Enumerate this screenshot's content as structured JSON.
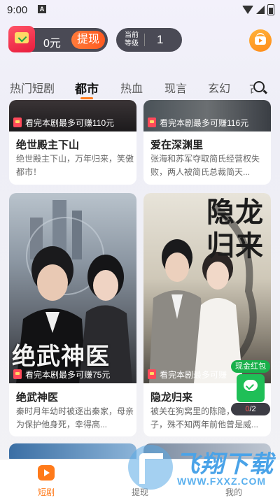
{
  "status_bar": {
    "time": "9:00",
    "alert": "A"
  },
  "header": {
    "coin_amount": "0元",
    "withdraw_label": "提现",
    "level_label": "当前等级",
    "level_value": "1"
  },
  "tabs": [
    {
      "label": "热门短剧",
      "active": false
    },
    {
      "label": "都市",
      "active": true
    },
    {
      "label": "热血",
      "active": false
    },
    {
      "label": "现言",
      "active": false
    },
    {
      "label": "玄幻",
      "active": false
    },
    {
      "label": "古",
      "active": false
    }
  ],
  "cards": [
    {
      "badge": "看完本剧最多可赚110元",
      "title": "绝世殿主下山",
      "desc": "绝世殿主下山，万年归来，笑傲都市！"
    },
    {
      "badge": "看完本剧最多可赚116元",
      "title": "爱在深渊里",
      "desc": "张海和苏军夺取简氏经营权失败，两人被简氏总裁简天..."
    },
    {
      "badge": "看完本剧最多可赚75元",
      "title": "绝武神医",
      "desc": "秦时月年幼时被逐出秦家，母亲为保护他身死，幸得高...",
      "poster_title": "绝武神医"
    },
    {
      "badge": "看完本剧最多可赚",
      "title": "隐龙归来",
      "desc": "被关在狗窝里的陈隐，被迫当了子，殊不知两年前他曾是威...",
      "poster_title": "隐龙归来"
    }
  ],
  "floating": {
    "label": "现金红包",
    "counter_current": "0",
    "counter_total": "/2"
  },
  "bottom_nav": [
    {
      "label": "短剧",
      "active": true
    },
    {
      "label": "提现",
      "active": false
    },
    {
      "label": "我的",
      "active": false
    }
  ],
  "watermark": {
    "text": "飞翔下载",
    "url": "WWW.FXXZ.COM"
  },
  "colors": {
    "accent": "#ff7a1a",
    "green": "#1fbf57",
    "pill": "#4a4a55"
  }
}
